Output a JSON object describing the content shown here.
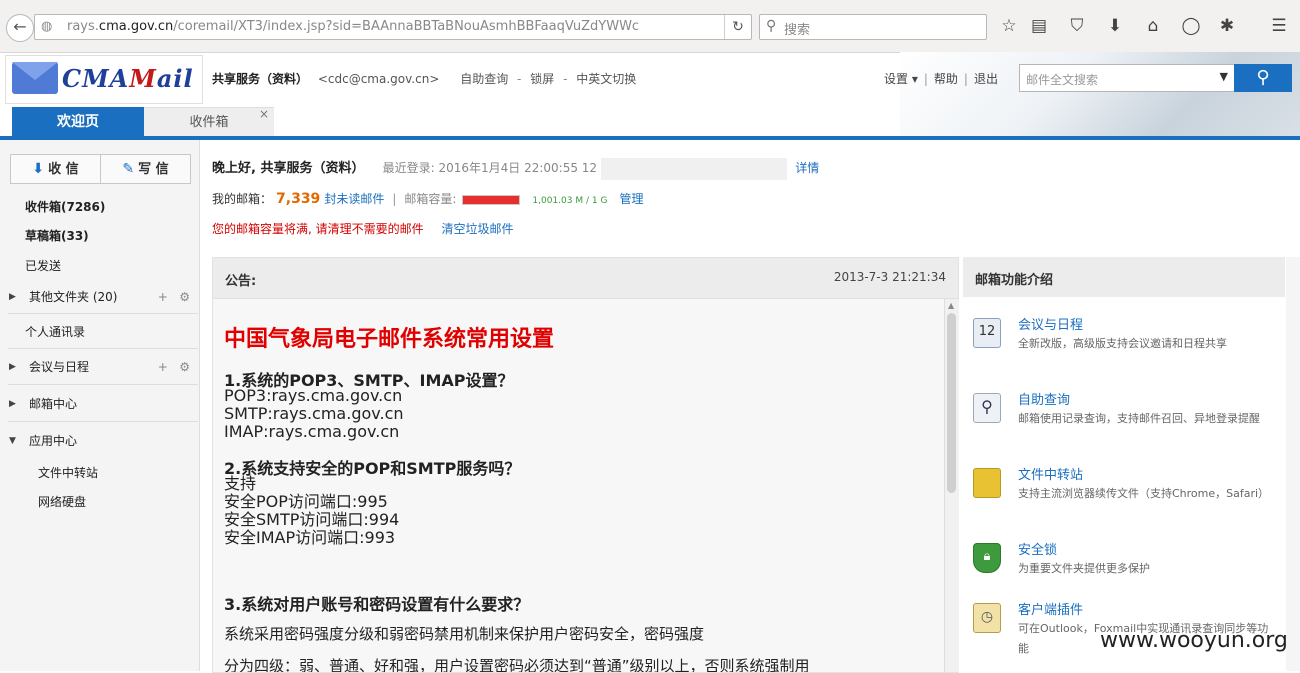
{
  "browser": {
    "url_prefix": "rays.",
    "url_domain": "cma.gov.cn",
    "url_path": "/coremail/XT3/index.jsp?sid=BAAnnaBBTaBNouAsmhBBFaaqVuZdYWWc",
    "search_placeholder": "搜索"
  },
  "header": {
    "user_name": "共享服务（资料）",
    "user_email": "<cdc@cma.gov.cn>",
    "links": [
      "自助查询",
      "锁屏",
      "中英文切换"
    ],
    "link_sep": "-",
    "settings": "设置 ▾",
    "help": "帮助",
    "logout": "退出",
    "search_placeholder": "邮件全文搜索"
  },
  "tabs": {
    "welcome": "欢迎页",
    "inbox": "收件箱"
  },
  "sidebar": {
    "receive": "收 信",
    "compose": "写 信",
    "inbox": "收件箱(7286)",
    "drafts": "草稿箱(33)",
    "sent": "已发送",
    "other_folders": "其他文件夹 (20)",
    "contacts": "个人通讯录",
    "calendar": "会议与日程",
    "mail_center": "邮箱中心",
    "app_center": "应用中心",
    "file_transfer": "文件中转站",
    "net_disk": "网络硬盘"
  },
  "welcome": {
    "greeting": "晚上好, 共享服务（资料）",
    "last_login": "最近登录: 2016年1月4日 22:00:55 12",
    "details": "详情",
    "my_mailbox": "我的邮箱：",
    "unread_count": "7,339",
    "unread_label": "封未读邮件",
    "capacity_label": "邮箱容量:",
    "capacity_used": "1,001.03 M / 1 G",
    "capacity_fraction": 1.0,
    "manage": "管理",
    "warning": "您的邮箱容量将满, 请清理不需要的邮件",
    "clear_junk": "清空垃圾邮件"
  },
  "announcement": {
    "label": "公告:",
    "date": "2013-7-3 21:21:34",
    "title": "中国气象局电子邮件系统常用设置",
    "q1": "1.系统的POP3、SMTP、IMAP设置？",
    "q1_lines": [
      "POP3:rays.cma.gov.cn",
      "SMTP:rays.cma.gov.cn",
      "IMAP:rays.cma.gov.cn"
    ],
    "q2": "2.系统支持安全的POP和SMTP服务吗？",
    "q2_lines": [
      "支持",
      "安全POP访问端口:995",
      "安全SMTP访问端口:994",
      "安全IMAP访问端口:993"
    ],
    "q3": "3.系统对用户账号和密码设置有什么要求？",
    "q3_p1": "系统采用密码强度分级和弱密码禁用机制来保护用户密码安全，密码强度",
    "q3_p2": "分为四级：弱、普通、好和强，用户设置密码必须达到“普通”级别以上，否则系统强制用"
  },
  "features": {
    "title": "邮箱功能介绍",
    "items": [
      {
        "name": "会议与日程",
        "desc": "全新改版，高级版支持会议邀请和日程共享"
      },
      {
        "name": "自助查询",
        "desc": "邮箱使用记录查询，支持邮件召回、异地登录提醒"
      },
      {
        "name": "文件中转站",
        "desc": "支持主流浏览器续传文件（支持Chrome，Safari）"
      },
      {
        "name": "安全锁",
        "desc": "为重要文件夹提供更多保护"
      },
      {
        "name": "客户端插件",
        "desc": "可在Outlook，Foxmail中实现通讯录查询同步等功能"
      }
    ]
  },
  "watermark": "www.wooyun.org",
  "colors": {
    "accent": "#1b6fc0",
    "warning": "#d40000",
    "unread": "#e06a00"
  }
}
